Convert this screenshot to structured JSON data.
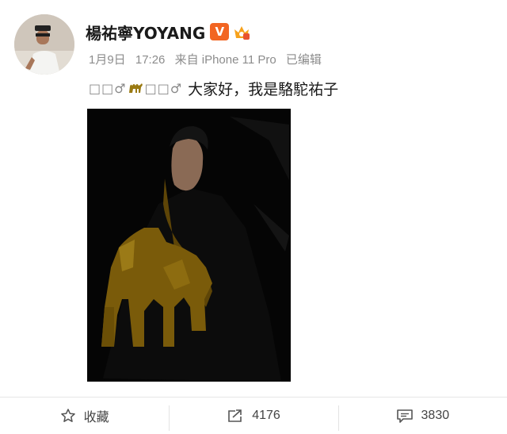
{
  "author": {
    "name": "楊祐寧YOYANG",
    "verified_badge": "V",
    "badge_color": "#f26522"
  },
  "meta": {
    "date": "1月9日",
    "time": "17:26",
    "source": "来自 iPhone 11 Pro",
    "edited": "已编辑"
  },
  "content": {
    "tofu_1": "□□",
    "male_1": "♂",
    "tofu_2": "□□",
    "male_2": "♂",
    "text": "大家好，我是駱駝祐子"
  },
  "actions": {
    "favorite_label": "收藏",
    "repost_count": "4176",
    "comment_count": "3830"
  },
  "icons": [
    "avatar",
    "v-badge-icon",
    "crown-badge-icon",
    "camel-icon",
    "star-icon",
    "repost-icon",
    "comment-icon"
  ],
  "colors": {
    "text": "#1a1a1a",
    "meta": "#8c8c8c",
    "camel": "#9a7a12"
  }
}
